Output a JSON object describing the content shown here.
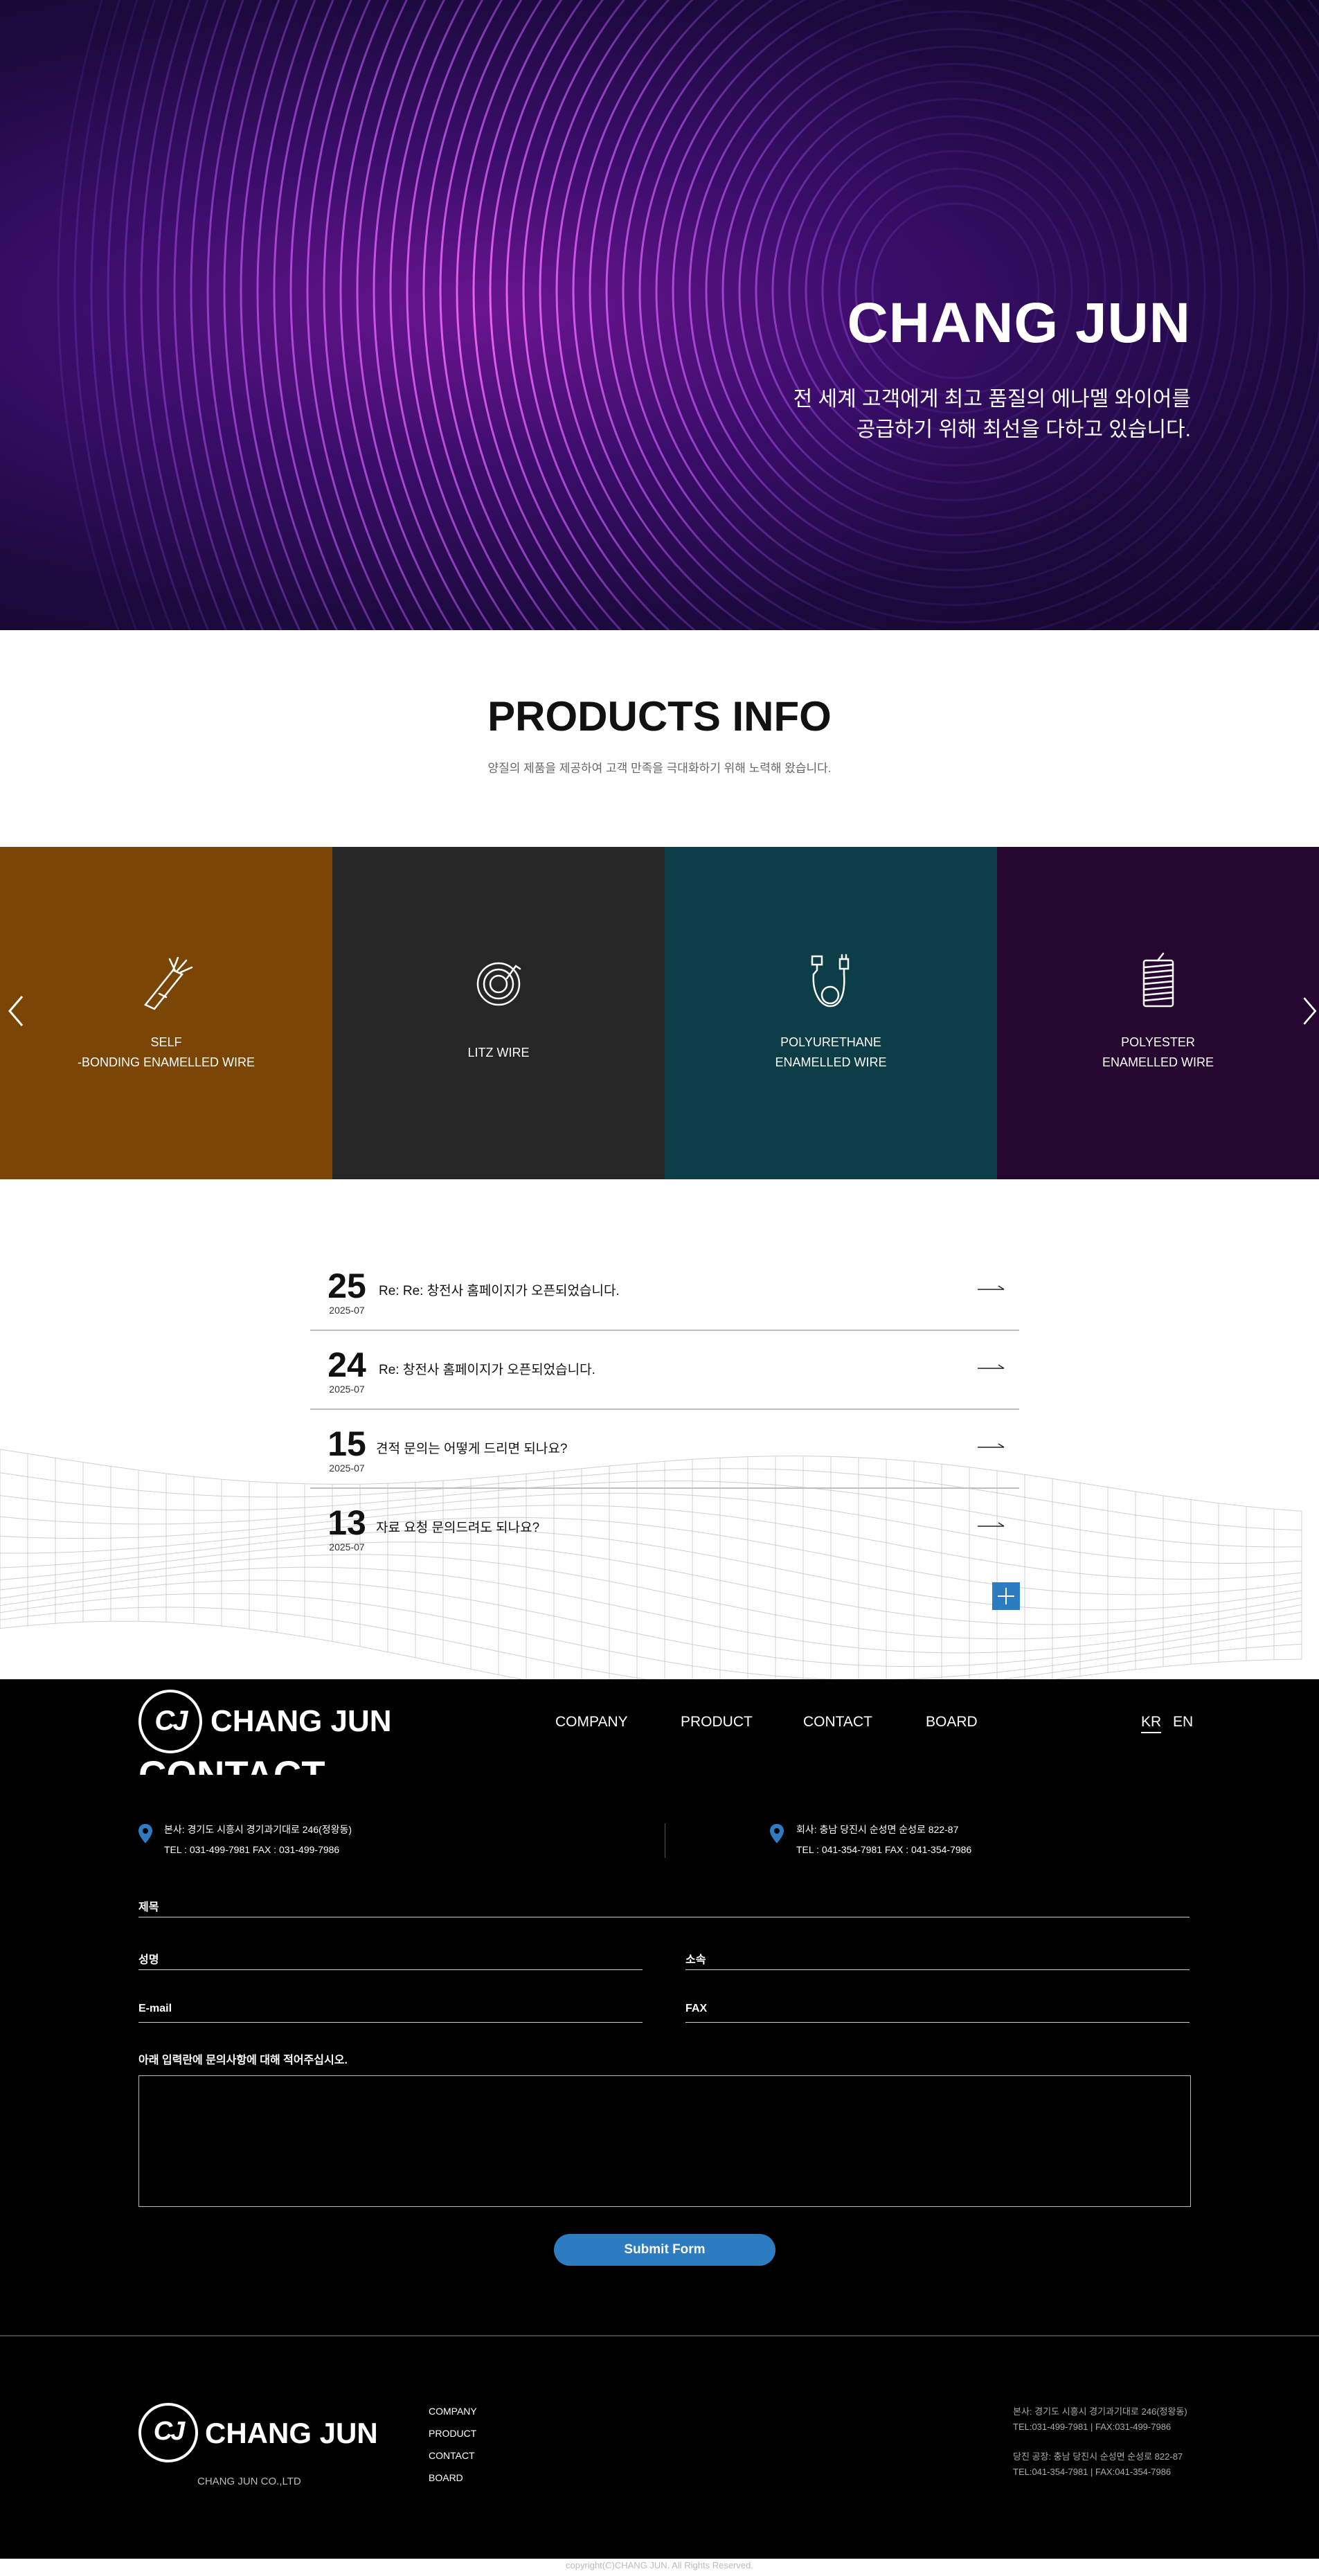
{
  "hero": {
    "title": "CHANG JUN",
    "subtitle_line1": "전 세계 고객에게 최고 품질의 에나멜 와이어를",
    "subtitle_line2": "공급하기 위해 최선을 다하고 있습니다."
  },
  "products_info": {
    "title": "PRODUCTS INFO",
    "subtitle": "양질의 제품을 제공하여 고객 만족을 극대화하기 위해 노력해 왔습니다."
  },
  "products": [
    {
      "line1": "SELF",
      "line2": "-BONDING ENAMELLED WIRE",
      "bg": "#7a4505",
      "icon": "stripped-wire-icon"
    },
    {
      "line1": "LITZ WIRE",
      "line2": "",
      "bg": "#262626",
      "icon": "coil-icon"
    },
    {
      "line1": "POLYURETHANE",
      "line2": "ENAMELLED WIRE",
      "bg": "#0d3d47",
      "icon": "cable-plug-icon"
    },
    {
      "line1": "POLYESTER",
      "line2": "ENAMELLED WIRE",
      "bg": "#25072f",
      "icon": "spool-icon"
    }
  ],
  "board": [
    {
      "day": "25",
      "ym": "2025-07",
      "title": "Re: Re: 창전사 홈페이지가 오픈되었습니다."
    },
    {
      "day": "24",
      "ym": "2025-07",
      "title": "Re: 창전사 홈페이지가 오픈되었습니다."
    },
    {
      "day": "15",
      "ym": "2025-07",
      "title": "견적 문의는 어떻게 드리면 되나요?"
    },
    {
      "day": "13",
      "ym": "2025-07",
      "title": "자료 요청 문의드려도 되나요?"
    }
  ],
  "header": {
    "logo_text": "CHANG JUN",
    "logo_mark": "CJ",
    "nav": [
      "COMPANY",
      "PRODUCT",
      "CONTACT",
      "BOARD"
    ],
    "lang_kr": "KR",
    "lang_en": "EN"
  },
  "contact": {
    "heading": "CONTACT",
    "hq_address": "본사: 경기도 시흥시 경기과기대로 246(정왕동)",
    "hq_tel": "TEL : 031-499-7981   FAX : 031-499-7986",
    "factory_address": "회사: 충남 당진시 순성면 순성로 822-87",
    "factory_tel": "TEL : 041-354-7981   FAX : 041-354-7986",
    "fields": {
      "subject": "제목",
      "name": "성명",
      "affiliation": "소속",
      "email": "E-mail",
      "fax": "FAX",
      "message_label": "아래 입력란에 문의사항에 대해 적어주십시오."
    },
    "submit": "Submit Form"
  },
  "footer": {
    "logo_text": "CHANG JUN",
    "logo_mark": "CJ",
    "company": "CHANG JUN CO.,LTD",
    "links": [
      "COMPANY",
      "PRODUCT",
      "CONTACT",
      "BOARD"
    ],
    "info1": "본사: 경기도 시흥시 경기과기대로 246(정왕동)",
    "info2": "TEL:031-499-7981 | FAX:031-499-7986",
    "info3": "당진 공장: 충남 당진시 순성면 순성로 822-87",
    "info4": "TEL:041-354-7981 | FAX:041-354-7986",
    "copyright": "copyright(C)CHANG JUN. All Rights Reserved."
  }
}
